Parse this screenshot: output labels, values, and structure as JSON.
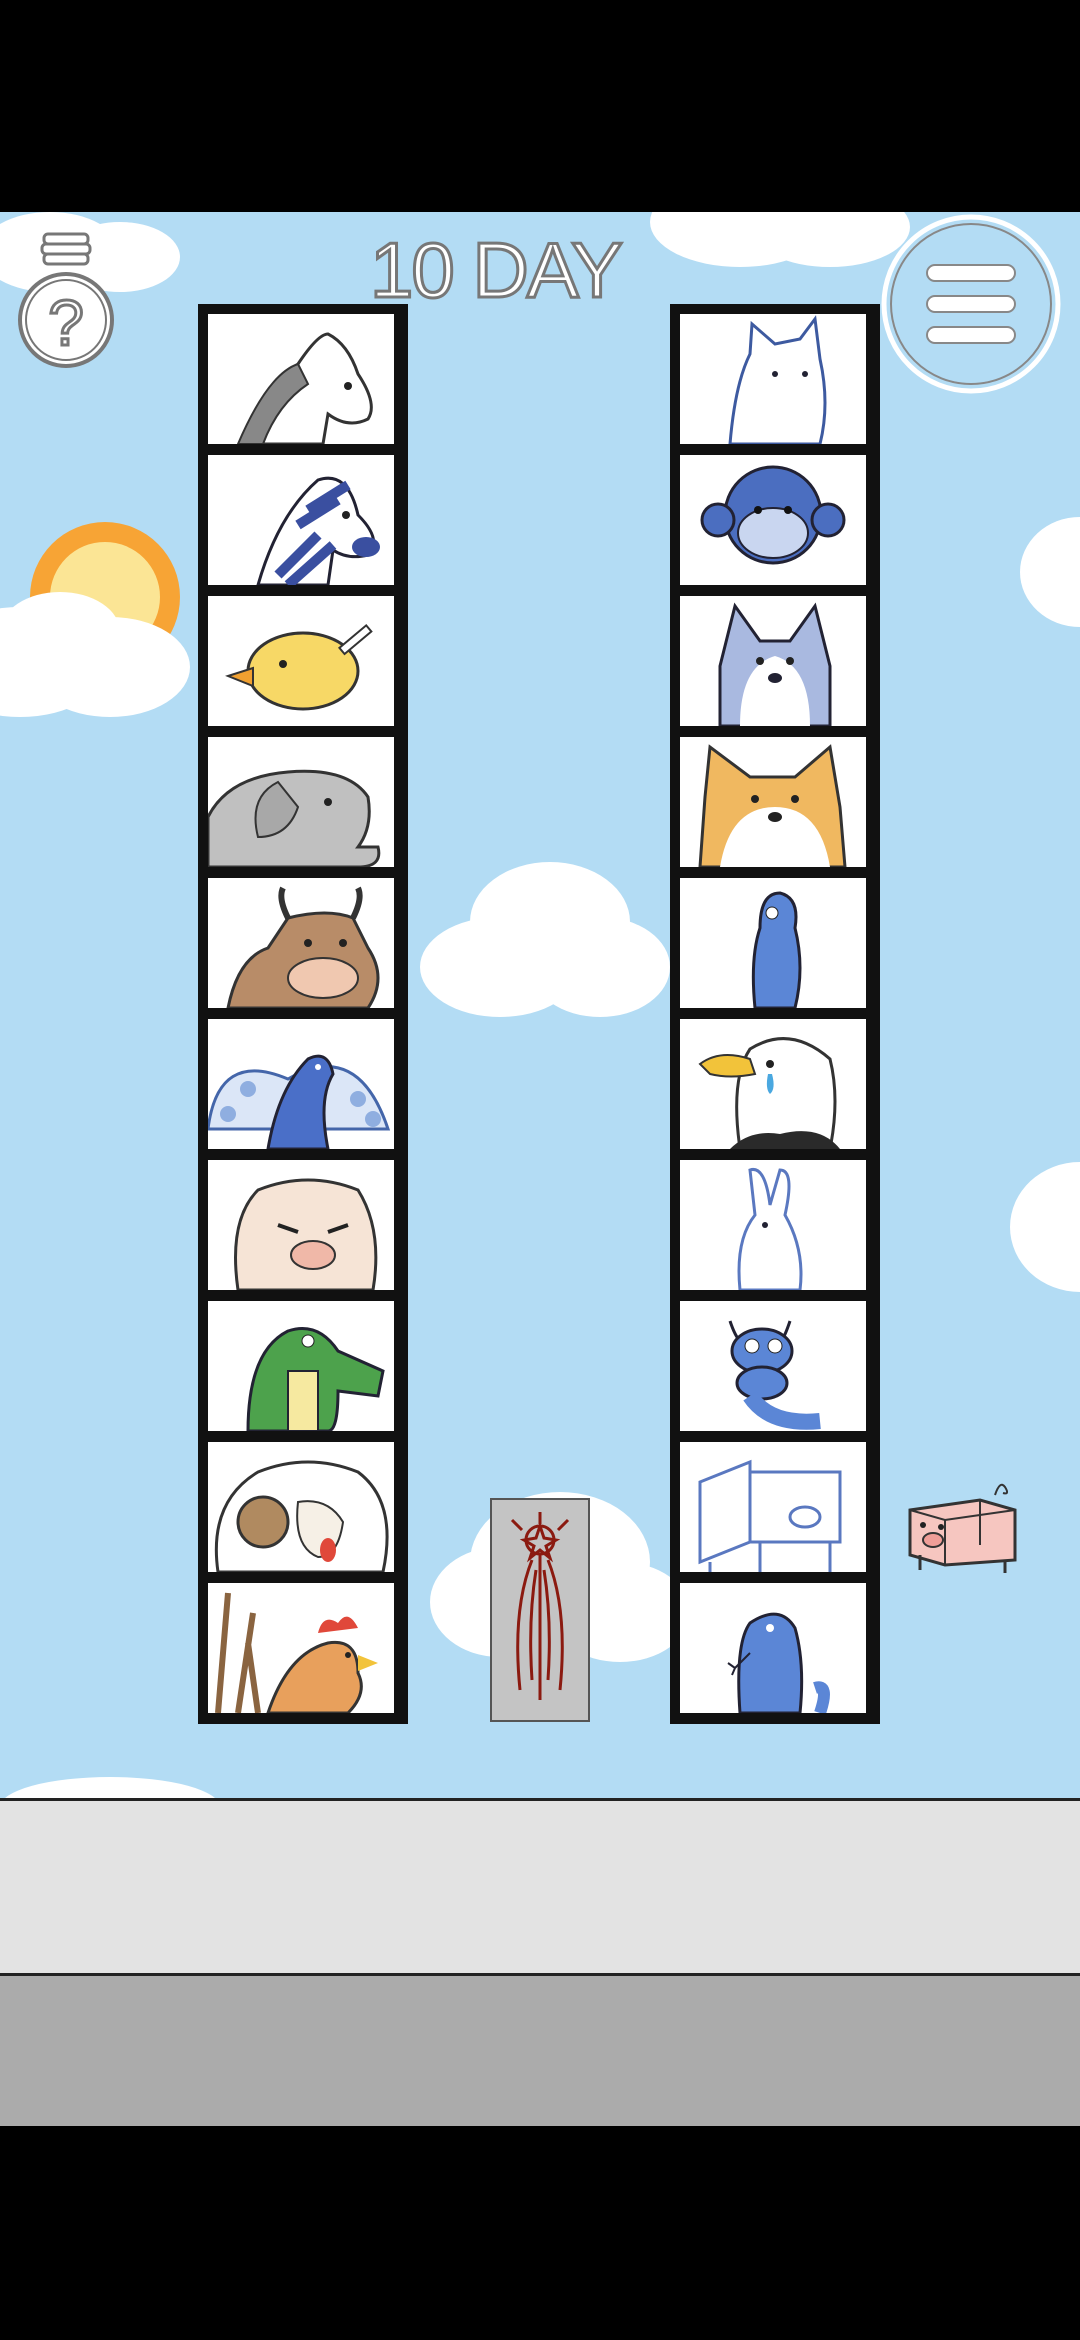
{
  "game": {
    "day_number": "10",
    "day_label": "DAY"
  },
  "colors": {
    "sky": "#b3dcf4",
    "frame": "#111111",
    "floor_light": "#e3e3e3",
    "floor_dark": "#ababab",
    "sun": "#f7a435",
    "seal_red": "#8b1a10"
  },
  "buttons": {
    "hint": "lightbulb-question-icon",
    "menu": "hamburger-menu-icon"
  },
  "left_column": [
    "horse",
    "zebra",
    "chick",
    "elephant",
    "ox",
    "peacock",
    "pig",
    "crocodile",
    "sheep",
    "rooster"
  ],
  "right_column": [
    "cat",
    "monkey",
    "husky",
    "corgi",
    "alien-creature",
    "eagle",
    "rabbit",
    "caterpillar",
    "pig-cart",
    "snake"
  ],
  "center_item": "talisman-scroll",
  "side_item": "pig-cart-small"
}
